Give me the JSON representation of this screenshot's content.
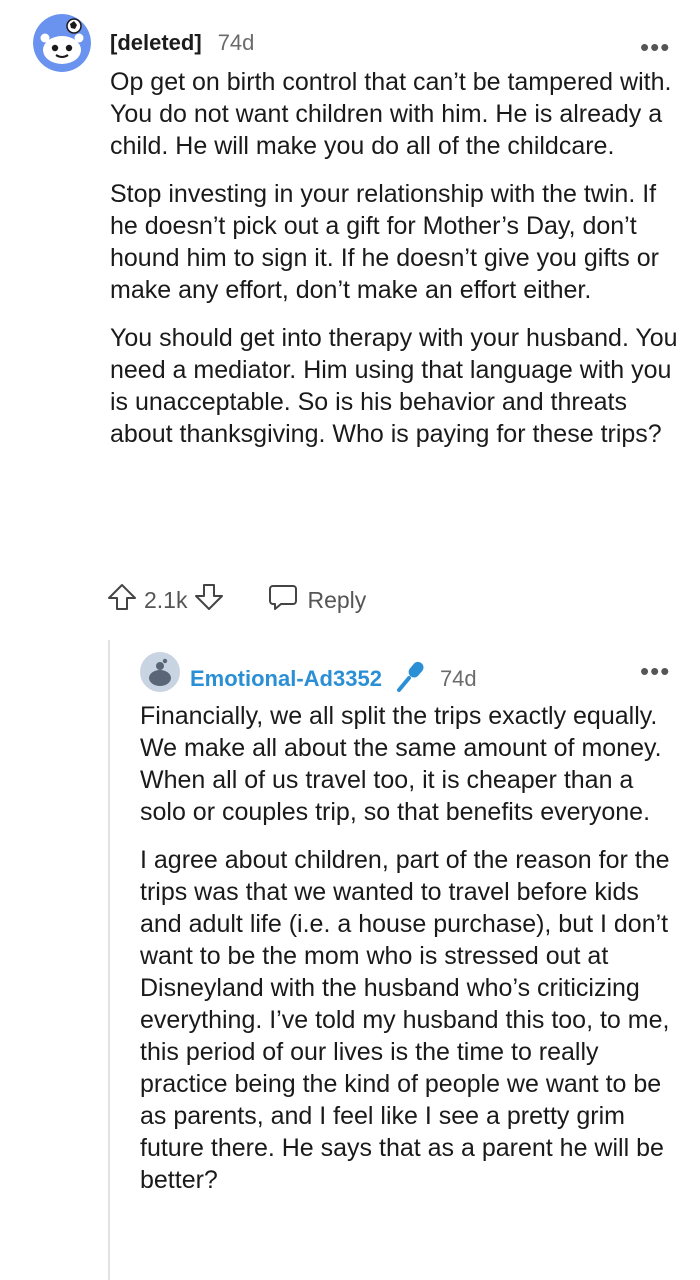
{
  "top_comment": {
    "author": "[deleted]",
    "age": "74d",
    "more_label": "•••",
    "paragraphs": [
      "Op get on birth control that can’t be tampered with. You do not want children with him. He is already a child. He will make you do all of the childcare.",
      "Stop investing in your relationship with the twin. If he doesn’t pick out a gift for Mother’s Day, don’t hound him to sign it. If he doesn’t give you gifts or make any effort, don’t make an effort either.",
      "You should get into therapy with your husband. You need a mediator. Him using that language with you is unacceptable. So is his behavior and threats about thanksgiving. Who is paying for these trips?"
    ],
    "vote_count": "2.1k",
    "reply_label": "Reply"
  },
  "reply_comment": {
    "author": "Emotional-Ad3352",
    "age": "74d",
    "more_label": "•••",
    "paragraphs": [
      "Financially, we all split the trips exactly equally. We make all about the same amount of money. When all of us travel too, it is cheaper than a solo or couples trip, so that benefits everyone.",
      "I agree about children, part of the reason for the trips was that we wanted to travel before kids and adult life (i.e. a house purchase), but I don’t want to be the mom who is stressed out at Disneyland with the husband who’s criticizing everything. I’ve told my husband this too, to me, this period of our lives is the time to really practice being the kind of people we want to be as parents, and I feel like I see a pretty grim future there. He says that as a parent he will be better?"
    ]
  },
  "icons": {
    "upvote": "upvote-arrow-icon",
    "downvote": "downvote-arrow-icon",
    "reply": "speech-bubble-icon",
    "op_badge": "microphone-icon",
    "more": "more-options-icon"
  },
  "colors": {
    "reply_author": "#2b8fd6",
    "text": "#1a1a1b",
    "muted": "#6b6b6b",
    "avatar_top_bg": "#e4ecff",
    "avatar_reply_bg": "#dce3ec"
  }
}
